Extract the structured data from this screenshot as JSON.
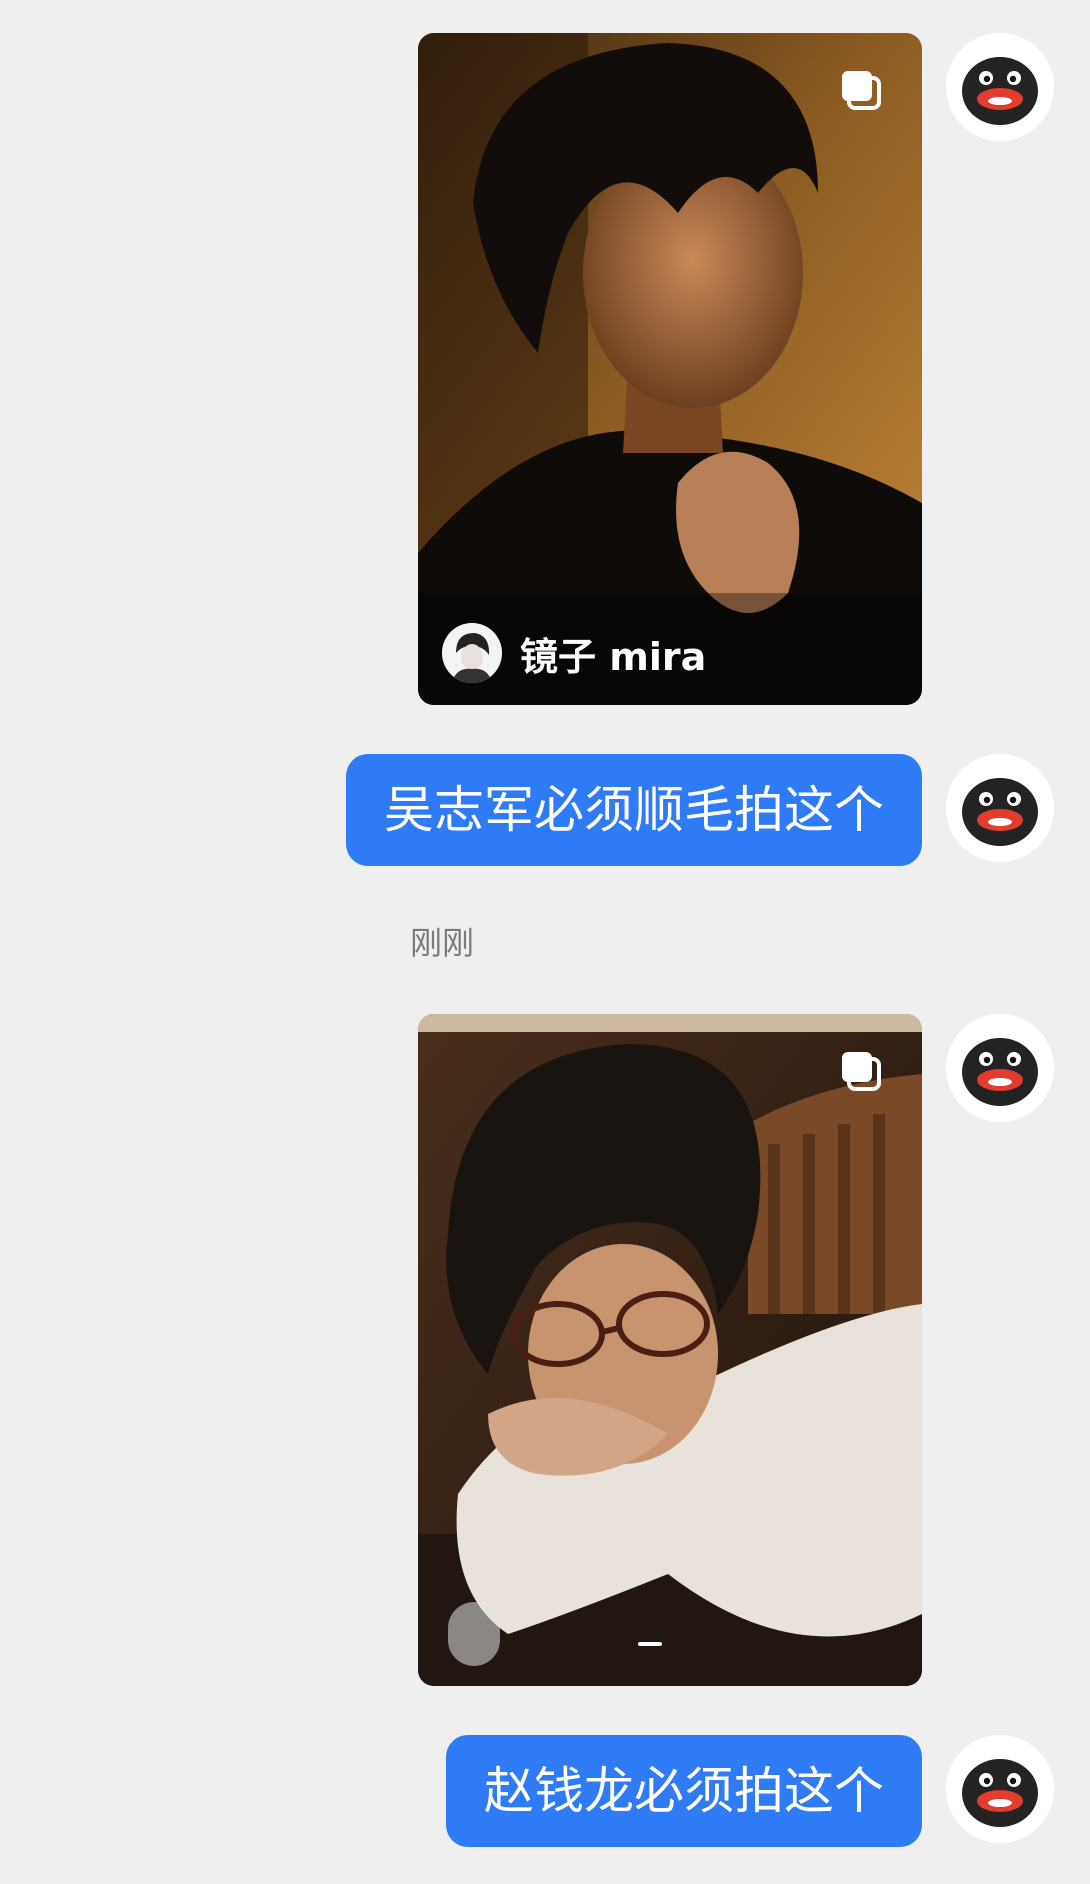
{
  "messages": {
    "card1": {
      "author_name": "镜子 mira",
      "media_icon": "multi-image-icon"
    },
    "bubble1": {
      "text": "吴志军必须顺毛拍这个"
    },
    "timestamp": {
      "text": "刚刚"
    },
    "card2": {
      "media_icon": "multi-image-icon"
    },
    "bubble2": {
      "text": "赵钱龙必须拍这个"
    }
  },
  "colors": {
    "background": "#efefef",
    "bubble": "#2f7bf5",
    "bubble_text": "#ffffff",
    "timestamp_text": "#7b7b7b"
  },
  "icons": {
    "self_avatar": "penguin-avatar-icon",
    "multi": "multi-image-icon"
  }
}
